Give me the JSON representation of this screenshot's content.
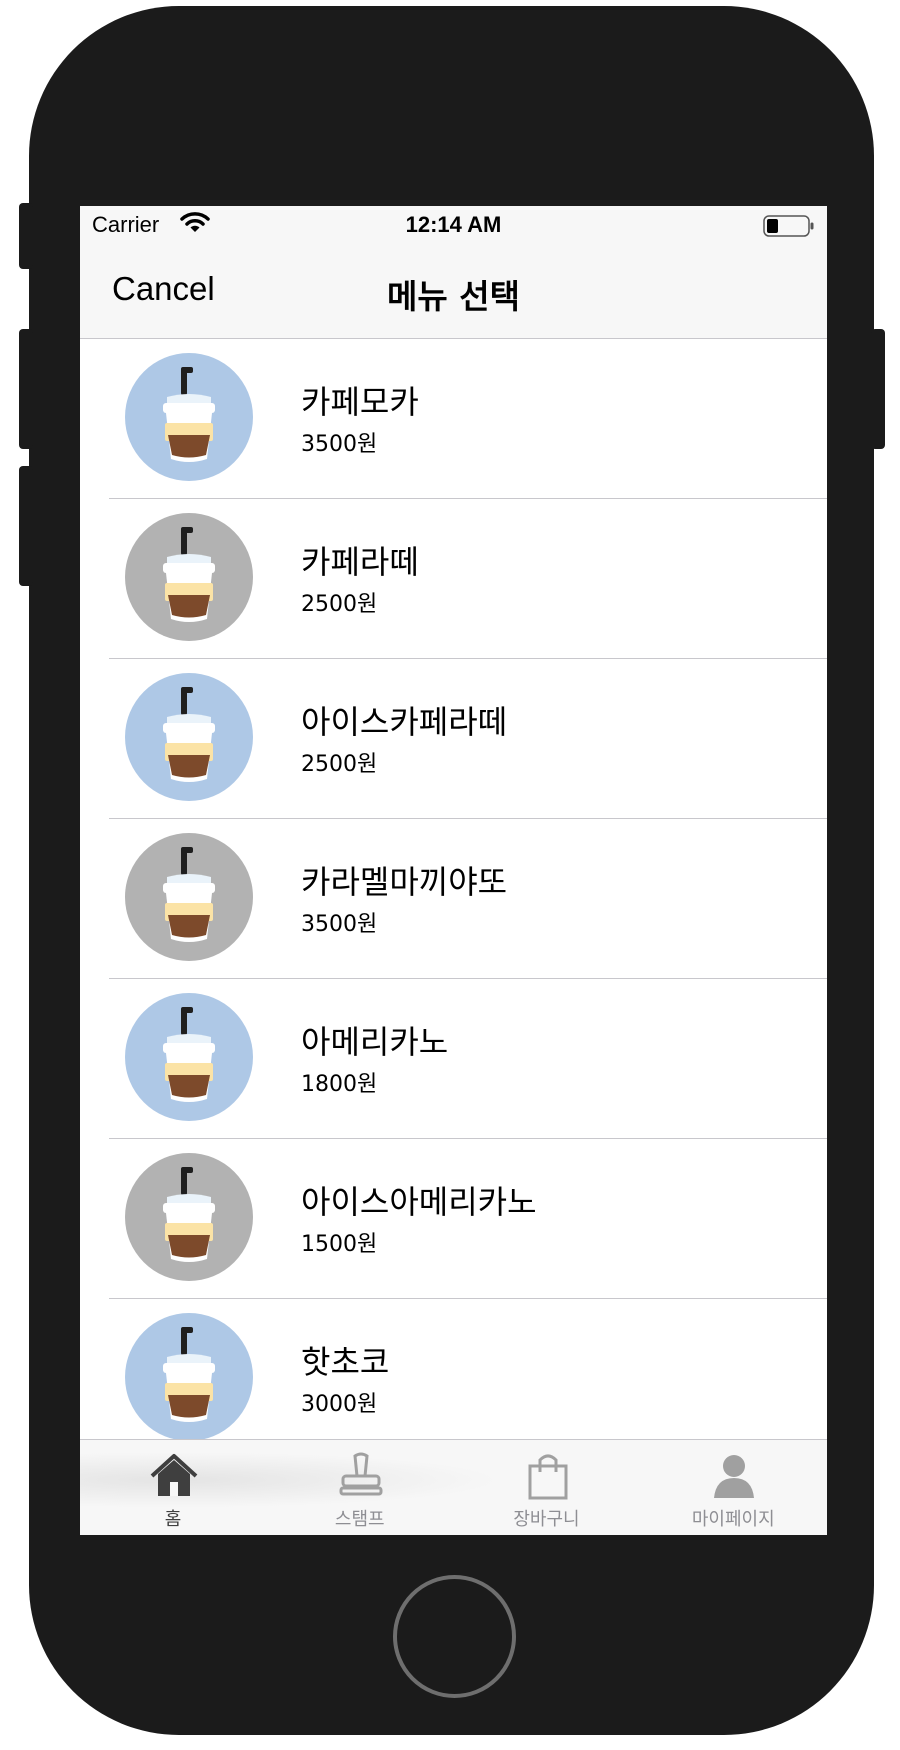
{
  "status_bar": {
    "carrier": "Carrier",
    "time": "12:14 AM",
    "icons": [
      "wifi-icon",
      "battery-icon"
    ]
  },
  "nav_bar": {
    "cancel_label": "Cancel",
    "title": "메뉴 선택"
  },
  "menu": {
    "items": [
      {
        "name": "카페모카",
        "price": "3500원",
        "thumb_bg": "#aec8e6",
        "icon": "coffee-cup-icon"
      },
      {
        "name": "카페라떼",
        "price": "2500원",
        "thumb_bg": "#b2b2b2",
        "icon": "coffee-cup-icon"
      },
      {
        "name": "아이스카페라떼",
        "price": "2500원",
        "thumb_bg": "#aec8e6",
        "icon": "coffee-cup-icon"
      },
      {
        "name": "카라멜마끼야또",
        "price": "3500원",
        "thumb_bg": "#b2b2b2",
        "icon": "coffee-cup-icon"
      },
      {
        "name": "아메리카노",
        "price": "1800원",
        "thumb_bg": "#aec8e6",
        "icon": "coffee-cup-icon"
      },
      {
        "name": "아이스아메리카노",
        "price": "1500원",
        "thumb_bg": "#b2b2b2",
        "icon": "coffee-cup-icon"
      },
      {
        "name": "핫초코",
        "price": "3000원",
        "thumb_bg": "#aec8e6",
        "icon": "coffee-cup-icon"
      }
    ]
  },
  "tab_bar": {
    "tabs": [
      {
        "label": "홈",
        "icon": "home-icon",
        "active": true
      },
      {
        "label": "스탬프",
        "icon": "stamp-icon",
        "active": false
      },
      {
        "label": "장바구니",
        "icon": "shopping-bag-icon",
        "active": false
      },
      {
        "label": "마이페이지",
        "icon": "user-icon",
        "active": false
      }
    ]
  },
  "colors": {
    "phone_frame": "#1b1b1b",
    "bar_background": "#f7f7f7",
    "separator": "#c8c7cc",
    "thumb_blue": "#aec8e6",
    "thumb_gray": "#b2b2b2",
    "tab_active": "#3f3f3f",
    "tab_inactive": "#8e8e93"
  }
}
